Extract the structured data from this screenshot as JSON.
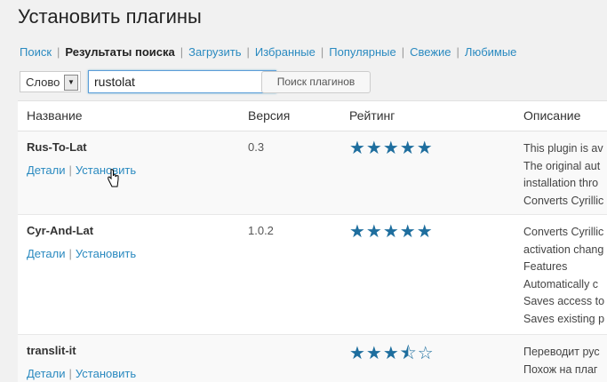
{
  "page": {
    "title": "Установить плагины"
  },
  "subnav": {
    "items": [
      "Поиск",
      "Результаты поиска",
      "Загрузить",
      "Избранные",
      "Популярные",
      "Свежие",
      "Любимые"
    ],
    "current_index": 1
  },
  "search": {
    "type_selected": "Слово",
    "query": "rustolat",
    "button_label": "Поиск плагинов"
  },
  "table": {
    "columns": {
      "name": "Название",
      "version": "Версия",
      "rating": "Рейтинг",
      "description": "Описание"
    },
    "rows": [
      {
        "name": "Rus-To-Lat",
        "action_details": "Детали",
        "action_install": "Установить",
        "version": "0.3",
        "rating": "5/5",
        "stars": "★★★★★",
        "desc_lines": [
          "This plugin is av",
          "The original aut",
          "installation thro",
          "Converts Cyrillic"
        ]
      },
      {
        "name": "Cyr-And-Lat",
        "action_details": "Детали",
        "action_install": "Установить",
        "version": "1.0.2",
        "rating": "5/5",
        "stars": "★★★★★",
        "desc_lines": [
          "Converts Cyrillic",
          "activation chang",
          "Features",
          "Automatically c",
          "Saves access to",
          "Saves existing p"
        ]
      },
      {
        "name": "translit-it",
        "action_details": "Детали",
        "action_install": "Установить",
        "version": "",
        "rating": "3.5/5",
        "stars": "★★★",
        "stars_half": "⯪",
        "stars_empty": "☆",
        "desc_lines": [
          "Переводит рус",
          "Похож на плаг"
        ]
      }
    ]
  },
  "colors": {
    "link": "#2a8ac0",
    "star": "#1e6e9e"
  }
}
